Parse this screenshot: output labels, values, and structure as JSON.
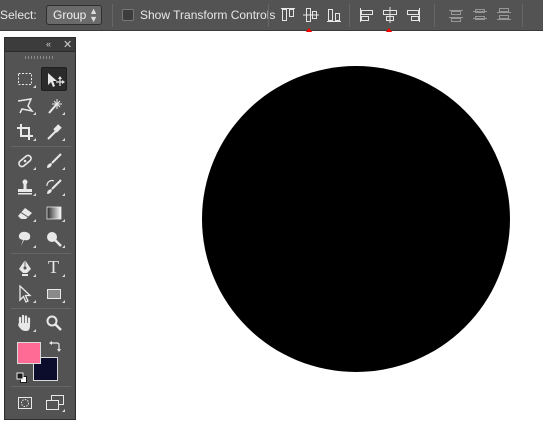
{
  "options_bar": {
    "select_label": "Select:",
    "group_select": {
      "value": "Group",
      "arrows_icon": "up-down-arrows-icon"
    },
    "show_transform_controls": {
      "label": "Show Transform Controls",
      "checked": false
    },
    "align_buttons": [
      "align-top-edges-icon",
      "align-vertical-centers-icon",
      "align-bottom-edges-icon",
      "align-left-edges-icon",
      "align-horizontal-centers-icon",
      "align-right-edges-icon"
    ],
    "distribute_buttons": [
      "distribute-top-icon",
      "distribute-vertical-centers-icon",
      "distribute-bottom-icon"
    ]
  },
  "tools_panel": {
    "titlebar": {
      "collapse_icon": "«",
      "close_icon": "✕"
    },
    "tools": [
      "rectangular-marquee-tool",
      "move-tool",
      "lasso-tool",
      "magic-wand-tool",
      "crop-tool",
      "eyedropper-tool",
      "spot-healing-brush-tool",
      "brush-tool",
      "clone-stamp-tool",
      "history-brush-tool",
      "eraser-tool",
      "gradient-tool",
      "blur-tool",
      "dodge-tool",
      "pen-tool",
      "type-tool",
      "path-selection-tool",
      "rectangle-tool",
      "hand-tool",
      "zoom-tool"
    ],
    "type_tool_glyph": "T",
    "foreground_color": "#ff6b94",
    "background_color": "#0c0c2c",
    "quick-mask": "quick-mask-icon",
    "screen_mode": "screen-mode-icon"
  },
  "canvas": {
    "background": "#ffffff",
    "shape": {
      "type": "circle",
      "fill": "#000000"
    }
  },
  "annotations": {
    "arrow_color": "#ff0000"
  }
}
